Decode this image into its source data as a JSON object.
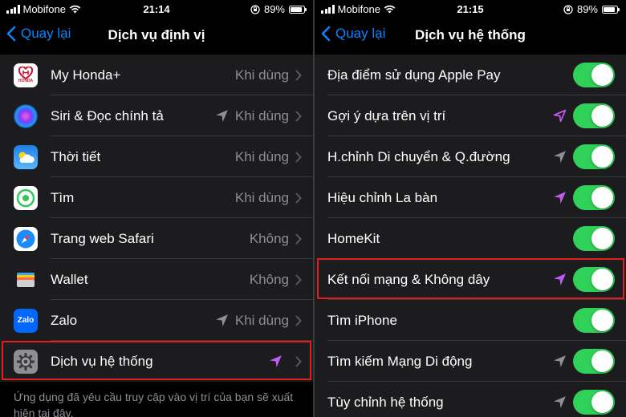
{
  "left_screen": {
    "status": {
      "carrier": "Mobifone",
      "time": "21:14",
      "battery": "89%"
    },
    "nav": {
      "back_label": "Quay lại",
      "title": "Dịch vụ định vị"
    },
    "apps": [
      {
        "name": "My Honda+",
        "status": "Khi dùng",
        "icon": "honda-icon",
        "location_arrow": false
      },
      {
        "name": "Siri & Đọc chính tả",
        "status": "Khi dùng",
        "icon": "siri-icon",
        "location_arrow": true
      },
      {
        "name": "Thời tiết",
        "status": "Khi dùng",
        "icon": "weather-icon",
        "location_arrow": false
      },
      {
        "name": "Tìm",
        "status": "Khi dùng",
        "icon": "find-my-icon",
        "location_arrow": false
      },
      {
        "name": "Trang web Safari",
        "status": "Không",
        "icon": "safari-icon",
        "location_arrow": false
      },
      {
        "name": "Wallet",
        "status": "Không",
        "icon": "wallet-icon",
        "location_arrow": false
      },
      {
        "name": "Zalo",
        "status": "Khi dùng",
        "icon": "zalo-icon",
        "location_arrow": true,
        "icon_text": "Zalo"
      },
      {
        "name": "Dịch vụ hệ thống",
        "status": "",
        "icon": "settings-gear-icon",
        "location_arrow": true,
        "arrow_color": "#bf5af2",
        "highlighted": true
      }
    ],
    "footer": "Ứng dụng đã yêu cầu truy cập vào vị trí của bạn sẽ xuất hiện tại đây."
  },
  "right_screen": {
    "status": {
      "carrier": "Mobifone",
      "time": "21:15",
      "battery": "89%"
    },
    "nav": {
      "back_label": "Quay lại",
      "title": "Dịch vụ hệ thống"
    },
    "services": [
      {
        "name": "Địa điểm sử dụng Apple Pay",
        "arrow": "none",
        "enabled": true
      },
      {
        "name": "Gợi ý dựa trên vị trí",
        "arrow": "purple-outline",
        "enabled": true
      },
      {
        "name": "H.chỉnh Di chuyển & Q.đường",
        "arrow": "gray",
        "enabled": true
      },
      {
        "name": "Hiệu chỉnh La bàn",
        "arrow": "purple",
        "enabled": true
      },
      {
        "name": "HomeKit",
        "arrow": "none",
        "enabled": true
      },
      {
        "name": "Kết nối mạng & Không dây",
        "arrow": "purple",
        "enabled": true,
        "highlighted": true
      },
      {
        "name": "Tìm iPhone",
        "arrow": "none",
        "enabled": true
      },
      {
        "name": "Tìm kiếm Mạng Di động",
        "arrow": "gray",
        "enabled": true
      },
      {
        "name": "Tùy chỉnh hệ thống",
        "arrow": "gray",
        "enabled": true
      }
    ]
  },
  "colors": {
    "accent_blue": "#0a84ff",
    "toggle_on": "#30d158",
    "location_purple": "#bf5af2",
    "location_gray": "#8e8e93",
    "highlight_red": "#e0201f",
    "cell_bg": "#1c1c1e"
  }
}
